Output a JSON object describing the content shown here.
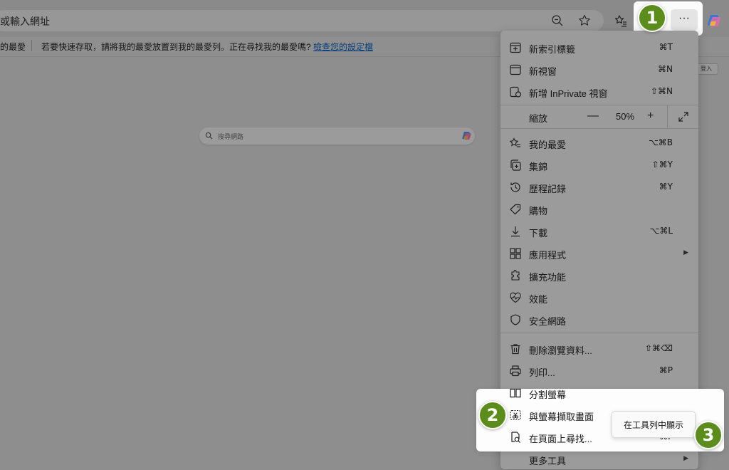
{
  "address_bar": {
    "placeholder": "或輸入網址"
  },
  "favorites_bar": {
    "item_left": "的最愛",
    "prompt": "若要快速存取，請將我的最愛放置到我的最愛列。正在尋找我的最愛嗎?",
    "link": "檢查您的設定檔"
  },
  "page": {
    "search_placeholder": "搜尋網路",
    "login_label": "登入"
  },
  "toolbar": {
    "more_label": "···"
  },
  "badges": {
    "one": "1",
    "two": "2",
    "three": "3"
  },
  "menu": {
    "items": [
      {
        "label": "新索引標籤",
        "shortcut": "⌘T",
        "icon": "new-tab-icon"
      },
      {
        "label": "新視窗",
        "shortcut": "⌘N",
        "icon": "new-window-icon"
      },
      {
        "label": "新增 InPrivate 視窗",
        "shortcut": "⇧⌘N",
        "icon": "inprivate-icon"
      },
      {
        "label": "我的最愛",
        "shortcut": "⌥⌘B",
        "icon": "favorites-icon"
      },
      {
        "label": "集錦",
        "shortcut": "⇧⌘Y",
        "icon": "collections-icon"
      },
      {
        "label": "歷程記錄",
        "shortcut": "⌘Y",
        "icon": "history-icon"
      },
      {
        "label": "購物",
        "shortcut": "",
        "icon": "shopping-icon"
      },
      {
        "label": "下載",
        "shortcut": "⌥⌘L",
        "icon": "download-icon"
      },
      {
        "label": "應用程式",
        "shortcut": "",
        "icon": "apps-icon"
      },
      {
        "label": "擴充功能",
        "shortcut": "",
        "icon": "extensions-icon"
      },
      {
        "label": "效能",
        "shortcut": "",
        "icon": "performance-icon"
      },
      {
        "label": "安全網路",
        "shortcut": "",
        "icon": "secure-network-icon"
      },
      {
        "label": "刪除瀏覽資料...",
        "shortcut": "⇧⌘⌫",
        "icon": "delete-icon"
      },
      {
        "label": "列印...",
        "shortcut": "⌘P",
        "icon": "print-icon"
      },
      {
        "label": "分割螢幕",
        "shortcut": "",
        "icon": "split-screen-icon"
      },
      {
        "label": "與螢幕擷取畫面",
        "shortcut": "",
        "icon": "screenshot-icon"
      },
      {
        "label": "在頁面上尋找...",
        "shortcut": "⌘F",
        "icon": "find-icon"
      },
      {
        "label": "更多工具",
        "shortcut": "",
        "icon": "more-tools-icon"
      }
    ],
    "zoom": {
      "label": "縮放",
      "value": "50%",
      "minus": "—",
      "plus": "+"
    }
  },
  "tooltip": {
    "label": "在工具列中顯示"
  },
  "colors": {
    "badge": "#5a8d1a",
    "link": "#083f7a"
  }
}
